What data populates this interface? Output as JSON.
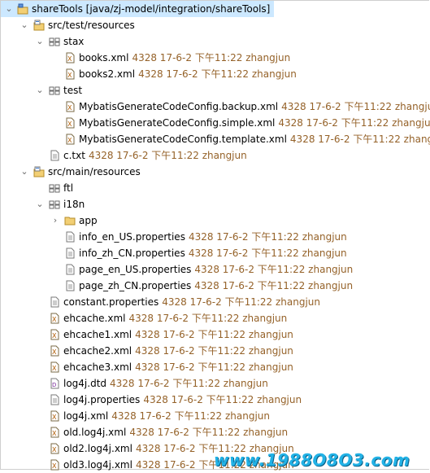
{
  "project": {
    "label": "shareTools [java/zj-model/integration/shareTools]"
  },
  "tree": [
    {
      "type": "srcfolder",
      "level": 1,
      "expanded": true,
      "name": "src/test/resources"
    },
    {
      "type": "package",
      "level": 2,
      "expanded": true,
      "name": "stax"
    },
    {
      "type": "xml",
      "level": 3,
      "name": "books.xml",
      "meta": "4328  17-6-2 下午11:22  zhangjun"
    },
    {
      "type": "xml",
      "level": 3,
      "name": "books2.xml",
      "meta": "4328  17-6-2 下午11:22  zhangjun"
    },
    {
      "type": "package",
      "level": 2,
      "expanded": true,
      "name": "test"
    },
    {
      "type": "xml",
      "level": 3,
      "name": "MybatisGenerateCodeConfig.backup.xml",
      "meta": "4328  17-6-2 下午11:22  zhangju"
    },
    {
      "type": "xml",
      "level": 3,
      "name": "MybatisGenerateCodeConfig.simple.xml",
      "meta": "4328  17-6-2 下午11:22  zhangjur"
    },
    {
      "type": "xml",
      "level": 3,
      "name": "MybatisGenerateCodeConfig.template.xml",
      "meta": "4328  17-6-2 下午11:22  zhang"
    },
    {
      "type": "file",
      "level": 2,
      "name": "c.txt",
      "meta": "4328  17-6-2 下午11:22  zhangjun"
    },
    {
      "type": "srcfolder",
      "level": 1,
      "expanded": true,
      "name": "src/main/resources"
    },
    {
      "type": "package",
      "level": 2,
      "name": "ftl"
    },
    {
      "type": "package",
      "level": 2,
      "expanded": true,
      "name": "i18n"
    },
    {
      "type": "folder",
      "level": 3,
      "collapsed": true,
      "name": "app"
    },
    {
      "type": "file",
      "level": 3,
      "name": "info_en_US.properties",
      "meta": "4328  17-6-2 下午11:22  zhangjun"
    },
    {
      "type": "file",
      "level": 3,
      "name": "info_zh_CN.properties",
      "meta": "4328  17-6-2 下午11:22  zhangjun"
    },
    {
      "type": "file",
      "level": 3,
      "name": "page_en_US.properties",
      "meta": "4328  17-6-2 下午11:22  zhangjun"
    },
    {
      "type": "file",
      "level": 3,
      "name": "page_zh_CN.properties",
      "meta": "4328  17-6-2 下午11:22  zhangjun"
    },
    {
      "type": "file",
      "level": 2,
      "name": "constant.properties",
      "meta": "4328  17-6-2 下午11:22  zhangjun"
    },
    {
      "type": "xml",
      "level": 2,
      "name": "ehcache.xml",
      "meta": "4328  17-6-2 下午11:22  zhangjun"
    },
    {
      "type": "xml",
      "level": 2,
      "name": "ehcache1.xml",
      "meta": "4328  17-6-2 下午11:22  zhangjun"
    },
    {
      "type": "xml",
      "level": 2,
      "name": "ehcache2.xml",
      "meta": "4328  17-6-2 下午11:22  zhangjun"
    },
    {
      "type": "xml",
      "level": 2,
      "name": "ehcache3.xml",
      "meta": "4328  17-6-2 下午11:22  zhangjun"
    },
    {
      "type": "dtd",
      "level": 2,
      "name": "log4j.dtd",
      "meta": "4328  17-6-2 下午11:22  zhangjun"
    },
    {
      "type": "file",
      "level": 2,
      "name": "log4j.properties",
      "meta": "4328  17-6-2 下午11:22  zhangjun"
    },
    {
      "type": "xml",
      "level": 2,
      "name": "log4j.xml",
      "meta": "4328  17-6-2 下午11:22  zhangjun"
    },
    {
      "type": "xml",
      "level": 2,
      "name": "old.log4j.xml",
      "meta": "4328  17-6-2 下午11:22  zhangjun"
    },
    {
      "type": "xml",
      "level": 2,
      "name": "old2.log4j.xml",
      "meta": "4328  17-6-2 下午11:22  zhangjun"
    },
    {
      "type": "xml",
      "level": 2,
      "name": "old3.log4j.xml",
      "meta": "4328  17-6-2 下午11:22  zhangjun"
    }
  ],
  "watermark": "www.1988O8O3.com",
  "colors": {
    "selection": "#cce8ff",
    "meta": "#956229",
    "watermark": "#22b2e6"
  }
}
